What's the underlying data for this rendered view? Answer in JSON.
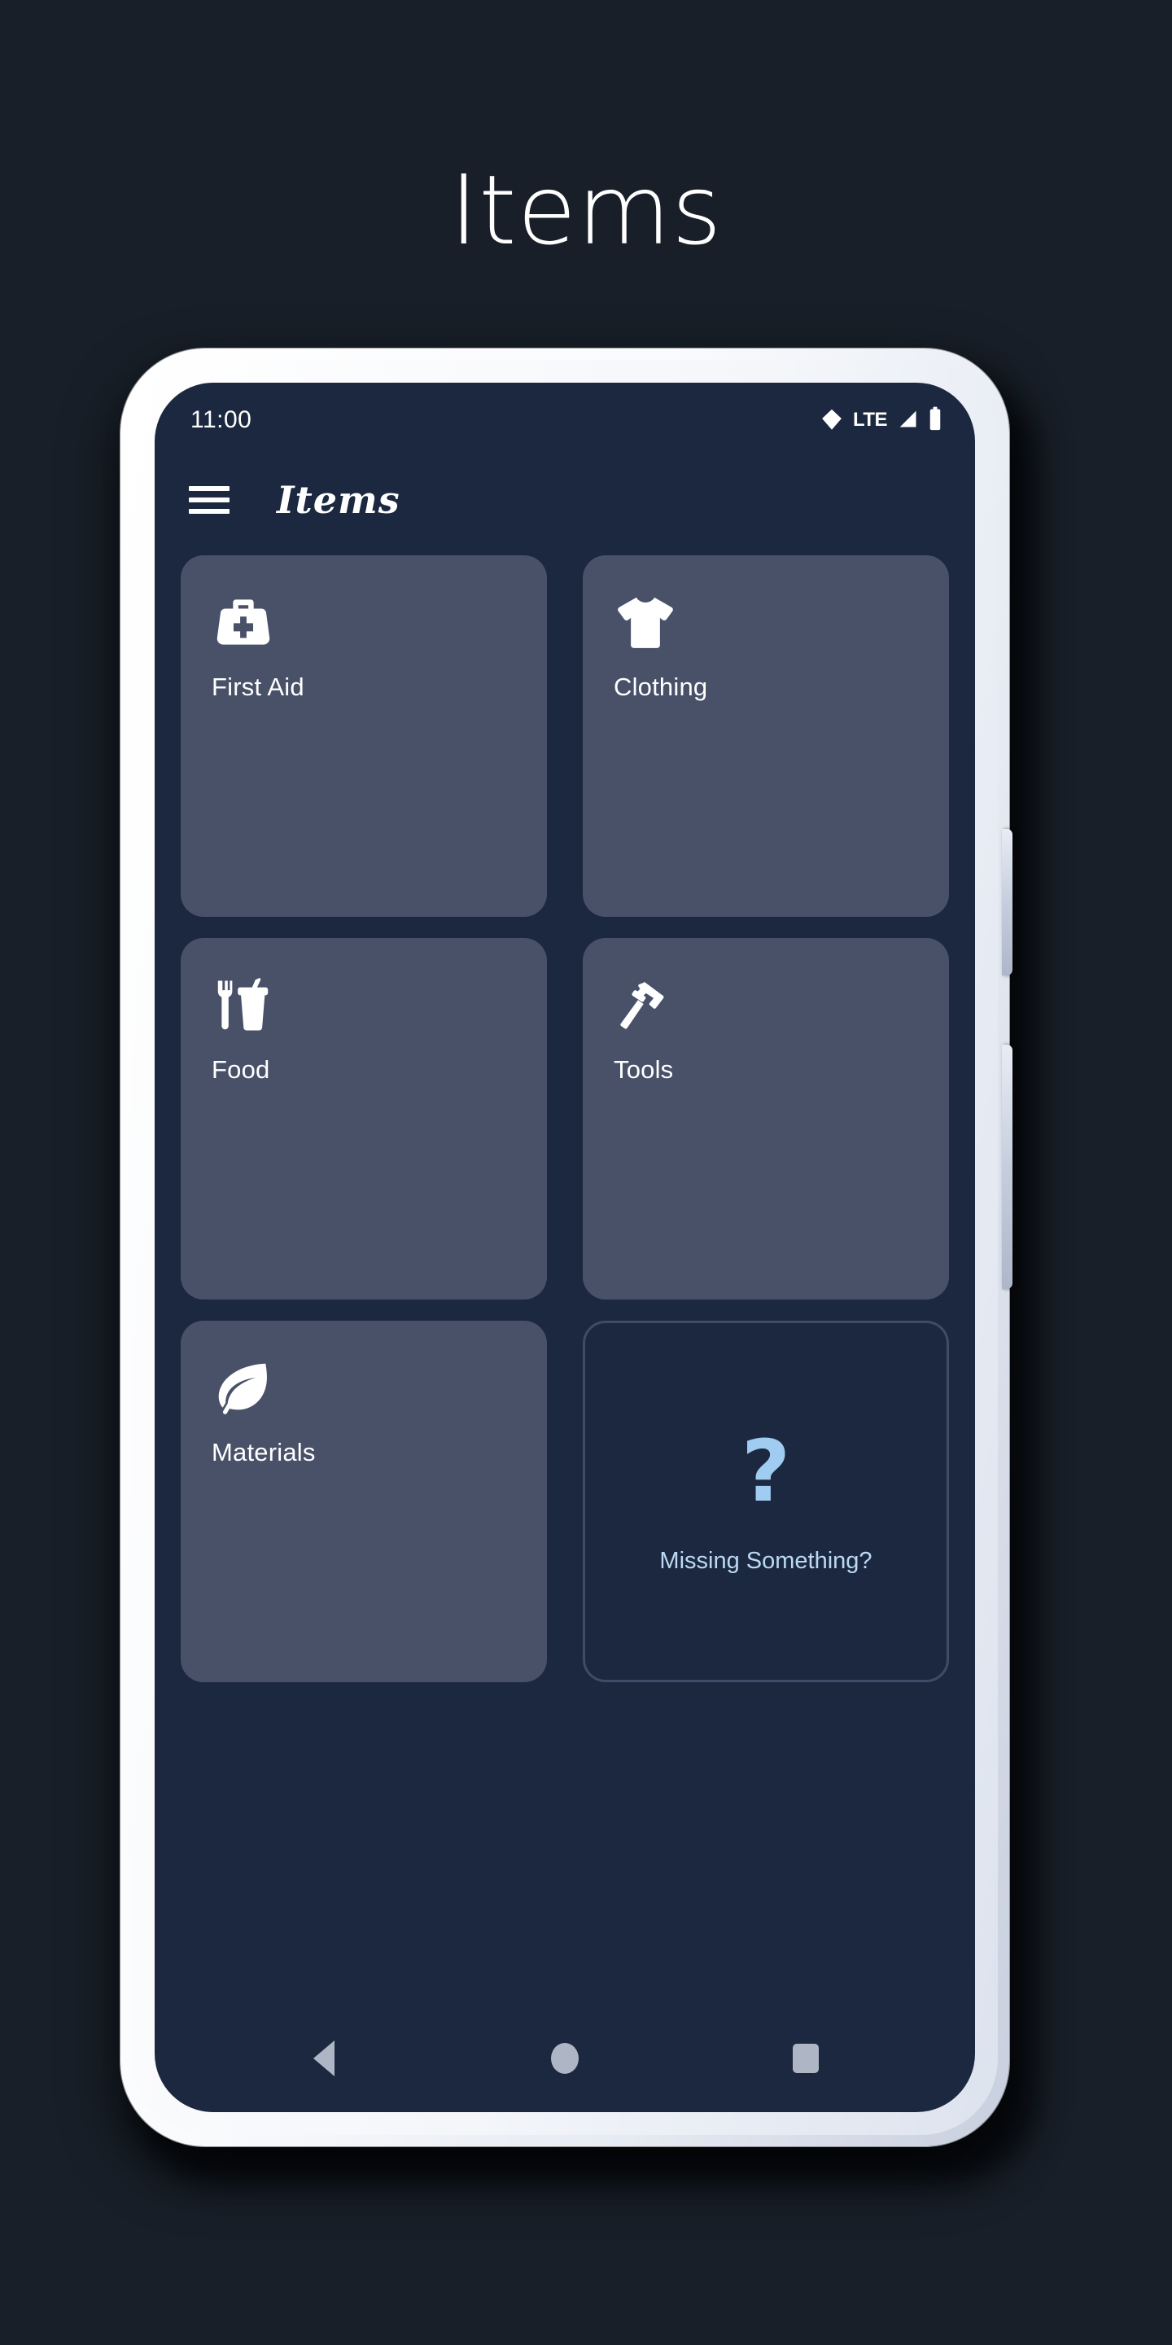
{
  "page": {
    "heading": "Items",
    "background_color": "#181F28"
  },
  "device": {
    "frame_color": "#FFFFFF",
    "screen_background": "#1C2840",
    "side_buttons": [
      "volume-rocker",
      "power-button"
    ]
  },
  "status_bar": {
    "time": "11:00",
    "icons": [
      {
        "name": "wifi-icon",
        "label": ""
      },
      {
        "name": "lte-indicator",
        "label": "LTE"
      },
      {
        "name": "cellular-signal-icon",
        "label": ""
      },
      {
        "name": "battery-icon",
        "label": ""
      }
    ]
  },
  "app_bar": {
    "menu_icon": "hamburger-menu-icon",
    "title": "Items"
  },
  "grid": {
    "card_color": "#495169",
    "cards": [
      {
        "label": "First Aid",
        "icon": "medical-bag-icon"
      },
      {
        "label": "Clothing",
        "icon": "t-shirt-icon"
      },
      {
        "label": "Food",
        "icon": "fastfood-icon"
      },
      {
        "label": "Tools",
        "icon": "hammer-icon"
      },
      {
        "label": "Materials",
        "icon": "leaf-icon"
      }
    ],
    "missing_card": {
      "symbol": "?",
      "label": "Missing Something?",
      "accent_color": "#9FCCF0",
      "border_color": "#3E4C68"
    }
  },
  "nav_bar": {
    "buttons": [
      {
        "name": "back-button",
        "icon": "triangle-left-icon"
      },
      {
        "name": "home-button",
        "icon": "circle-icon"
      },
      {
        "name": "recents-button",
        "icon": "square-icon"
      }
    ],
    "icon_color": "#AEB6C6"
  }
}
